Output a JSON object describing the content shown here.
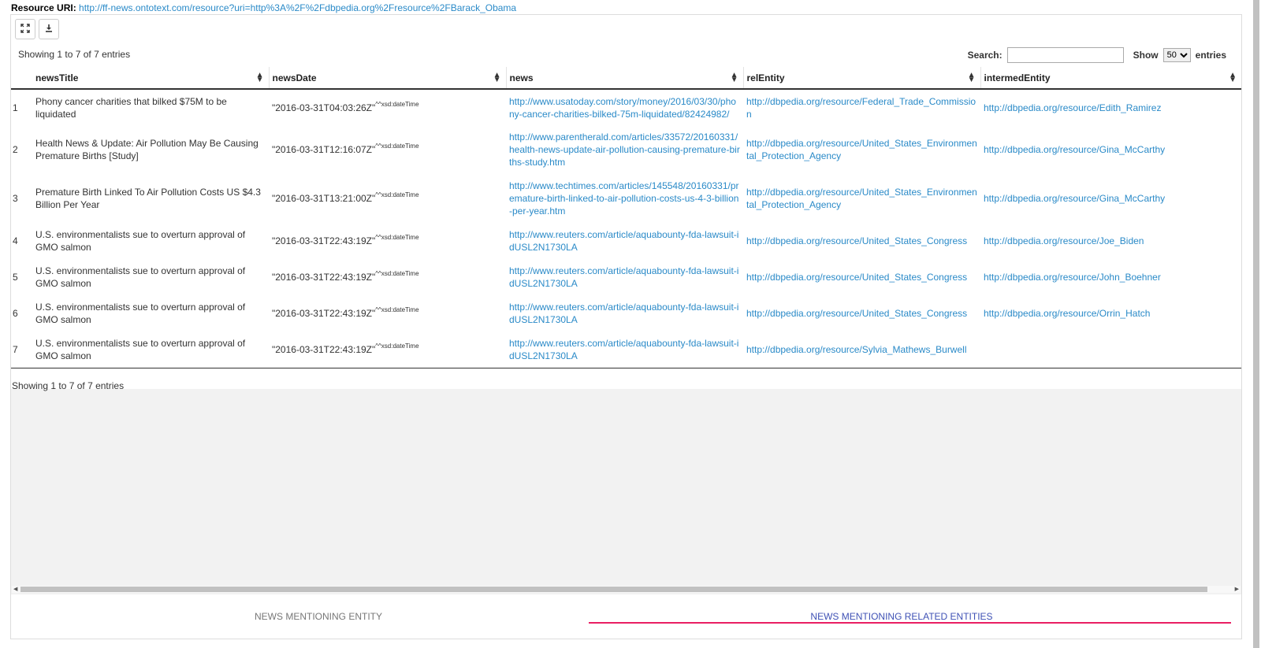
{
  "resource": {
    "label": "Resource URI:",
    "uri": "http://ff-news.ontotext.com/resource?uri=http%3A%2F%2Fdbpedia.org%2Fresource%2FBarack_Obama"
  },
  "toolbar": {
    "fullscreen_icon": "expand-icon",
    "download_icon": "download-icon"
  },
  "table_info": {
    "top": "Showing 1 to 7 of 7 entries",
    "bottom": "Showing 1 to 7 of 7 entries"
  },
  "search": {
    "label": "Search:",
    "value": "",
    "show_label": "Show",
    "page_size": "50",
    "entries_label": "entries"
  },
  "columns": [
    "newsTitle",
    "newsDate",
    "news",
    "relEntity",
    "intermedEntity"
  ],
  "rows": [
    {
      "n": "1",
      "newsTitle": "Phony cancer charities that bilked $75M to be liquidated",
      "date": "\"2016-03-31T04:03:26Z\"",
      "dtype": "^^xsd:dateTime",
      "news": "http://www.usatoday.com/story/money/2016/03/30/phony-cancer-charities-bilked-75m-liquidated/82424982/",
      "relEntity": "http://dbpedia.org/resource/Federal_Trade_Commission",
      "intermedEntity": "http://dbpedia.org/resource/Edith_Ramirez"
    },
    {
      "n": "2",
      "newsTitle": "Health News & Update: Air Pollution May Be Causing Premature Births [Study]",
      "date": "\"2016-03-31T12:16:07Z\"",
      "dtype": "^^xsd:dateTime",
      "news": "http://www.parentherald.com/articles/33572/20160331/health-news-update-air-pollution-causing-premature-births-study.htm",
      "relEntity": "http://dbpedia.org/resource/United_States_Environmental_Protection_Agency",
      "intermedEntity": "http://dbpedia.org/resource/Gina_McCarthy"
    },
    {
      "n": "3",
      "newsTitle": "Premature Birth Linked To Air Pollution Costs US $4.3 Billion Per Year",
      "date": "\"2016-03-31T13:21:00Z\"",
      "dtype": "^^xsd:dateTime",
      "news": "http://www.techtimes.com/articles/145548/20160331/premature-birth-linked-to-air-pollution-costs-us-4-3-billion-per-year.htm",
      "relEntity": "http://dbpedia.org/resource/United_States_Environmental_Protection_Agency",
      "intermedEntity": "http://dbpedia.org/resource/Gina_McCarthy"
    },
    {
      "n": "4",
      "newsTitle": "U.S. environmentalists sue to overturn approval of GMO salmon",
      "date": "\"2016-03-31T22:43:19Z\"",
      "dtype": "^^xsd:dateTime",
      "news": "http://www.reuters.com/article/aquabounty-fda-lawsuit-idUSL2N1730LA",
      "relEntity": "http://dbpedia.org/resource/United_States_Congress",
      "intermedEntity": "http://dbpedia.org/resource/Joe_Biden"
    },
    {
      "n": "5",
      "newsTitle": "U.S. environmentalists sue to overturn approval of GMO salmon",
      "date": "\"2016-03-31T22:43:19Z\"",
      "dtype": "^^xsd:dateTime",
      "news": "http://www.reuters.com/article/aquabounty-fda-lawsuit-idUSL2N1730LA",
      "relEntity": "http://dbpedia.org/resource/United_States_Congress",
      "intermedEntity": "http://dbpedia.org/resource/John_Boehner"
    },
    {
      "n": "6",
      "newsTitle": "U.S. environmentalists sue to overturn approval of GMO salmon",
      "date": "\"2016-03-31T22:43:19Z\"",
      "dtype": "^^xsd:dateTime",
      "news": "http://www.reuters.com/article/aquabounty-fda-lawsuit-idUSL2N1730LA",
      "relEntity": "http://dbpedia.org/resource/United_States_Congress",
      "intermedEntity": "http://dbpedia.org/resource/Orrin_Hatch"
    },
    {
      "n": "7",
      "newsTitle": "U.S. environmentalists sue to overturn approval of GMO salmon",
      "date": "\"2016-03-31T22:43:19Z\"",
      "dtype": "^^xsd:dateTime",
      "news": "http://www.reuters.com/article/aquabounty-fda-lawsuit-idUSL2N1730LA",
      "relEntity": "http://dbpedia.org/resource/Sylvia_Mathews_Burwell",
      "intermedEntity": ""
    }
  ],
  "tabs": [
    {
      "label": "NEWS MENTIONING ENTITY",
      "active": false
    },
    {
      "label": "NEWS MENTIONING RELATED ENTITIES",
      "active": true
    }
  ],
  "colors": {
    "link": "#2a8ac8",
    "active_tab_text": "#3f51b5",
    "active_tab_indicator": "#e91e63"
  }
}
